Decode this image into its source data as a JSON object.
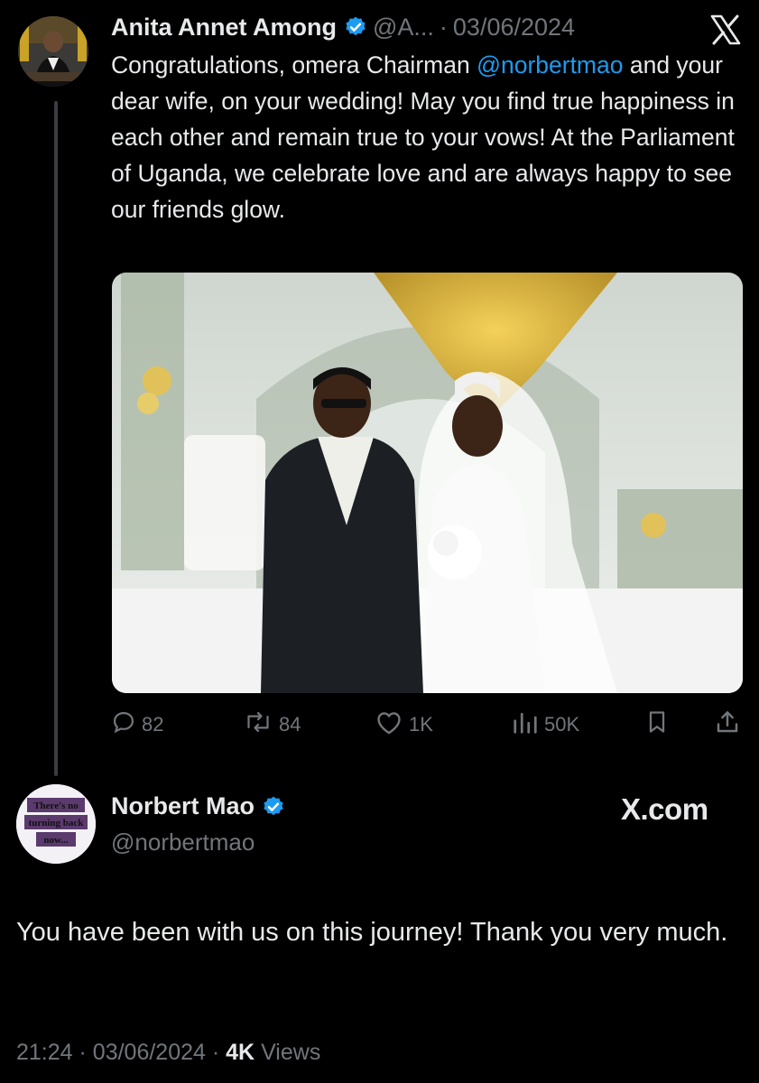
{
  "tweet": {
    "author_name": "Anita Annet Among",
    "handle_truncated": "@A...",
    "separator": "·",
    "date": "03/06/2024",
    "text_before_mention": "Congratulations, omera Chairman ",
    "mention": "@norbertmao",
    "text_after_mention": " and your dear wife, on your wedding! May you find true happiness in each other and remain true to your vows! At the Parliament of Uganda, we celebrate love and are always happy to see our friends glow.",
    "stats": {
      "replies": "82",
      "reposts": "84",
      "likes": "1K",
      "views": "50K"
    }
  },
  "reply": {
    "author_name": "Norbert Mao",
    "handle": "@norbertmao",
    "avatar_text": [
      "There's no",
      "turning back",
      "now..."
    ],
    "watermark": "X.com",
    "text": "You have been with us on this journey! Thank you very much.",
    "time": "21:24",
    "date": "03/06/2024",
    "views_count": "4K",
    "views_label": "Views"
  },
  "colors": {
    "background": "#000000",
    "text_primary": "#e7e9ea",
    "text_muted": "#71767b",
    "accent_blue": "#1d9bf0"
  },
  "icons": [
    "verified-badge-icon",
    "x-logo-icon",
    "reply-icon",
    "repost-icon",
    "like-icon",
    "views-icon",
    "bookmark-icon",
    "share-icon"
  ]
}
